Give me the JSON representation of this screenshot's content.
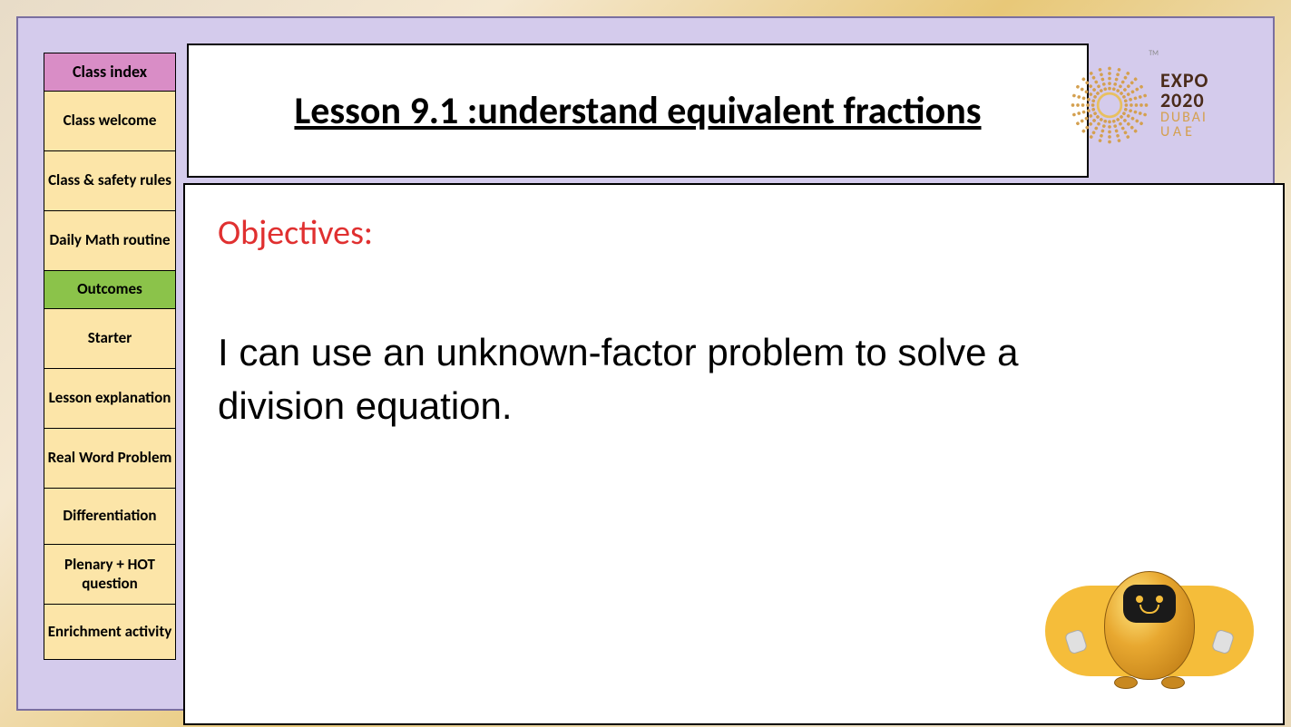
{
  "sidebar": {
    "header": "Class index",
    "items": [
      {
        "label": "Class welcome",
        "active": false
      },
      {
        "label": "Class & safety rules",
        "active": false
      },
      {
        "label": "Daily Math routine",
        "active": false
      },
      {
        "label": "Outcomes",
        "active": true
      },
      {
        "label": "Starter",
        "active": false
      },
      {
        "label": "Lesson explanation",
        "active": false
      },
      {
        "label": "Real Word Problem",
        "active": false
      },
      {
        "label": "Differentiation",
        "active": false
      },
      {
        "label": "Plenary + HOT question",
        "active": false
      },
      {
        "label": "Enrichment activity",
        "active": false
      }
    ]
  },
  "title": "Lesson 9.1 :understand equivalent fractions",
  "objectives": {
    "label": "Objectives:",
    "text": "I can use an unknown-factor problem to solve a division equation."
  },
  "expo": {
    "line1": "EXPO",
    "line2": "2020",
    "line3": "DUBAI",
    "line4": "UAE",
    "tm": "TM"
  }
}
